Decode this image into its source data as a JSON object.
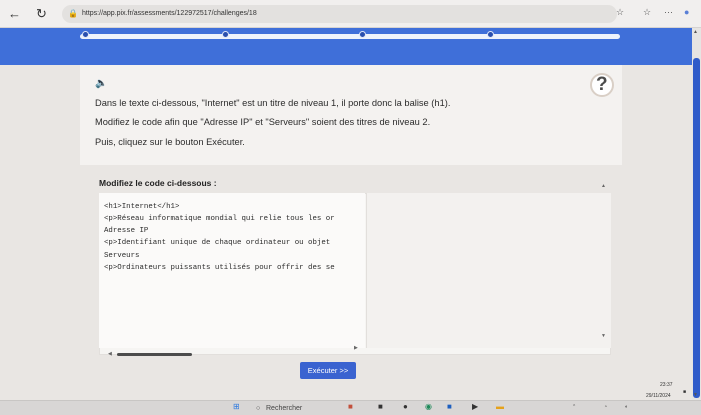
{
  "browser": {
    "url": "https://app.pix.fr/assessments/122972517/challenges/18"
  },
  "instructions": {
    "line1": "Dans le texte ci-dessous, \"Internet\" est un titre de niveau 1, il porte donc la balise (h1).",
    "line2": "Modifiez le code afin que \"Adresse IP\" et \"Serveurs\" soient des titres de niveau 2.",
    "line3": "Puis, cliquez sur le bouton Exécuter."
  },
  "help": {
    "label": "?"
  },
  "code": {
    "title": "Modifiez le code ci-dessous :",
    "lines": [
      "<h1>Internet</h1>",
      "<p>Réseau informatique mondial qui relie tous les or",
      "Adresse IP",
      "<p>Identifiant unique de chaque ordinateur ou objet",
      "Serveurs",
      "<p>Ordinateurs puissants utilisés pour offrir des se"
    ]
  },
  "run_button": {
    "label": "Exécuter >>"
  },
  "taskbar": {
    "search_label": "Rechercher",
    "time": "23:37",
    "date": "29/11/2024"
  },
  "colors": {
    "accent_blue": "#3f6fd9",
    "button_blue": "#3a63d0"
  },
  "progress_steps": {
    "total": 5,
    "current": 5
  }
}
